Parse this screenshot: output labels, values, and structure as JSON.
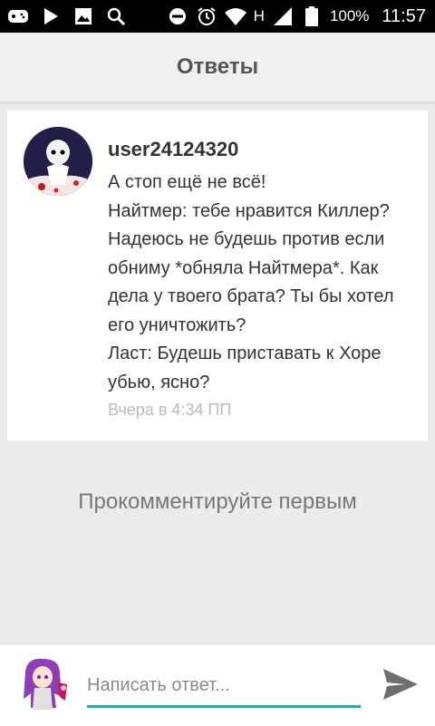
{
  "status_bar": {
    "network_label": "H",
    "battery": "100%",
    "time": "11:57"
  },
  "header": {
    "title": "Ответы"
  },
  "comment": {
    "username": "user24124320",
    "lines": [
      "А стоп ещё не всё!",
      "Найтмер: тебе нравится Киллер?",
      "Надеюсь не будешь против если",
      "обниму *обняла Найтмера*. Как",
      "дела у твоего брата? Ты бы хотел",
      "его уничтожить?",
      "Ласт: Будешь приставать к Хоре",
      "убью, ясно?"
    ],
    "timestamp": "Вчера в 4:34 ПП"
  },
  "empty_state": "Прокомментируйте первым",
  "reply": {
    "placeholder": "Написать ответ..."
  },
  "colors": {
    "accent": "#2aa5b3",
    "background": "#ebebeb",
    "status_bar": "#000000"
  },
  "icons": [
    "gamepad-icon",
    "play-store-icon",
    "gallery-icon",
    "search-icon",
    "dnd-icon",
    "alarm-icon",
    "wifi-icon",
    "signal-icon",
    "battery-icon",
    "send-icon"
  ]
}
